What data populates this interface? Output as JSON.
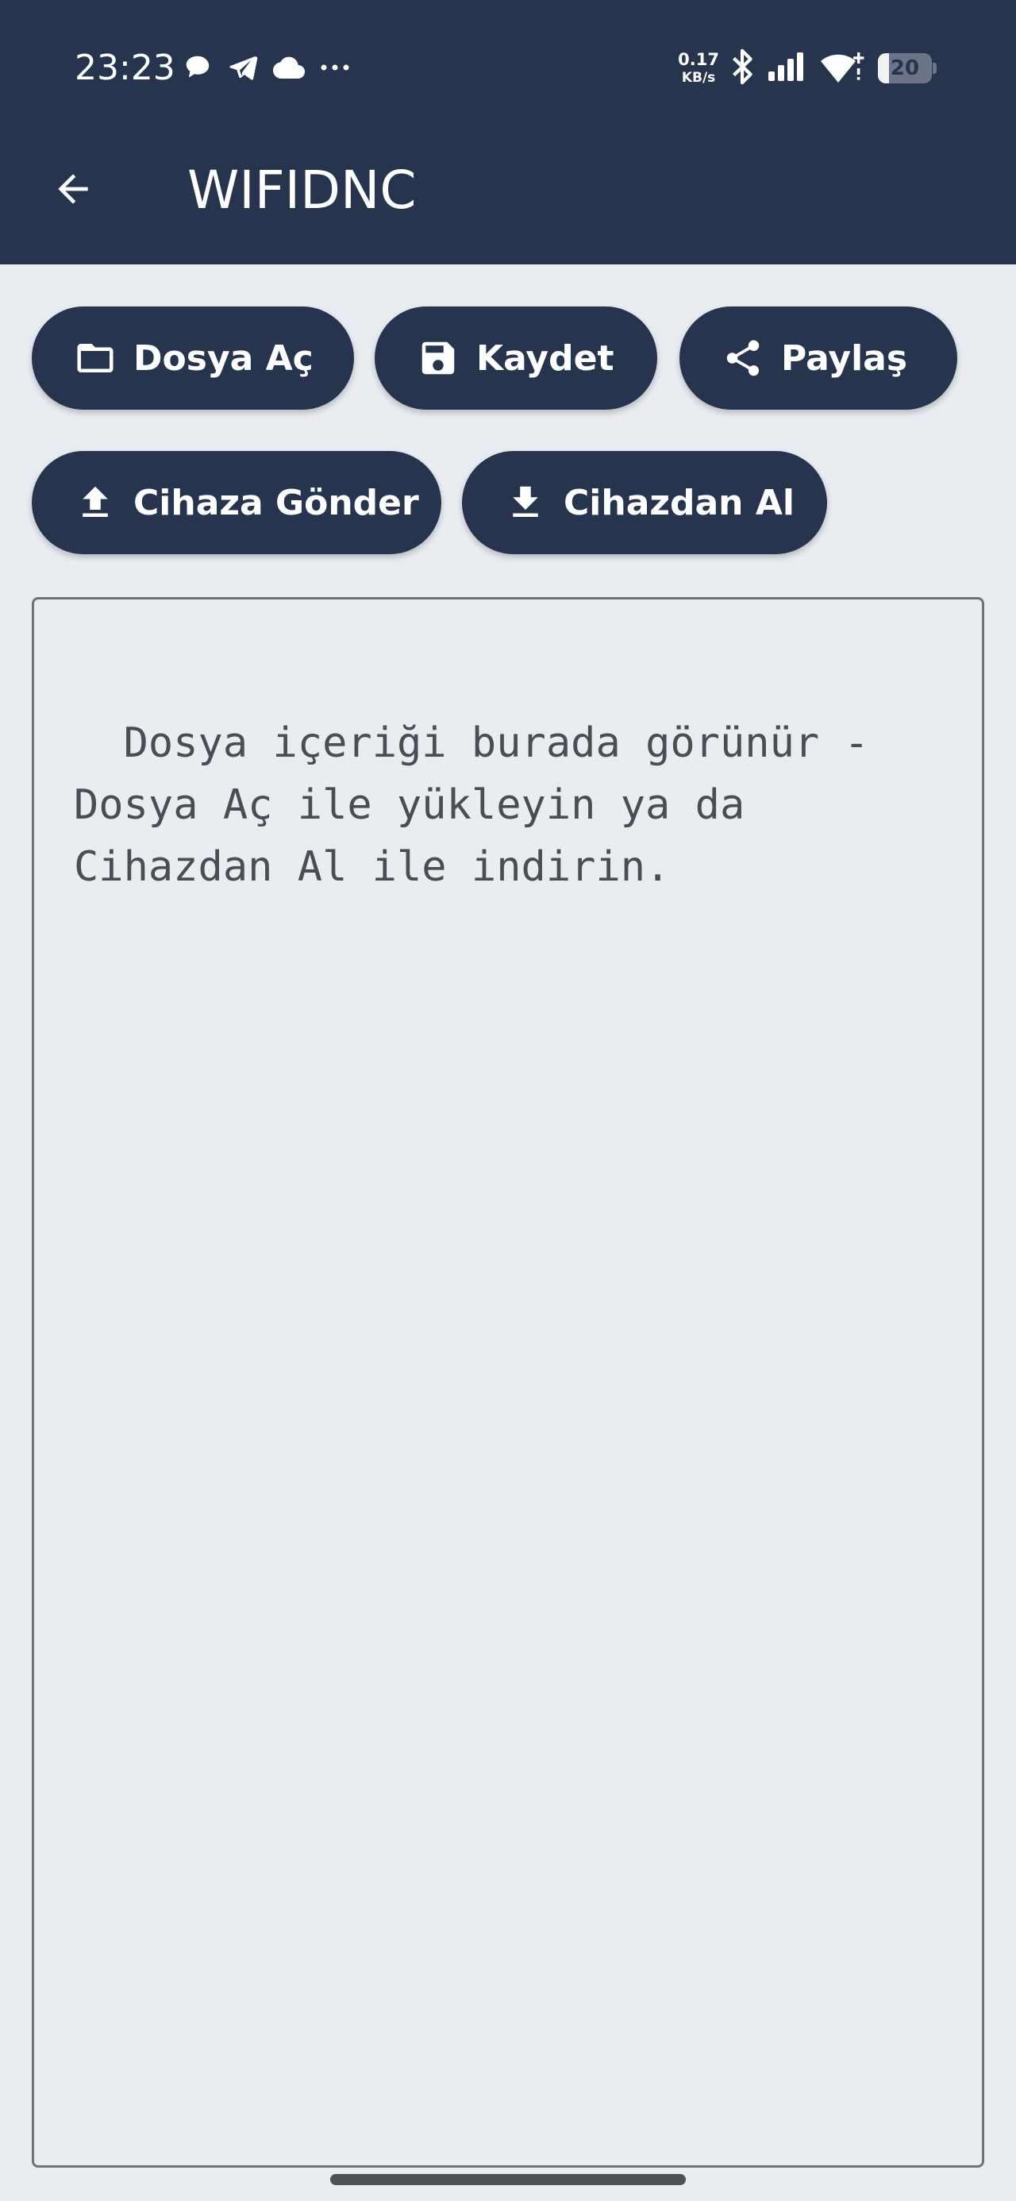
{
  "status_bar": {
    "time": "23:23",
    "net_speed_value": "0.17",
    "net_speed_unit": "KB/s",
    "battery_level": "20",
    "battery_fraction": 0.2
  },
  "app_bar": {
    "title": "WIFIDNC"
  },
  "toolbar": {
    "open_label": "Dosya Aç",
    "save_label": "Kaydet",
    "share_label": "Paylaş",
    "send_label": "Cihaza Gönder",
    "receive_label": "Cihazdan Al"
  },
  "editor": {
    "placeholder": "Dosya içeriği burada görünür -\nDosya Aç ile yükleyin ya da\nCihazdan Al ile indirin."
  },
  "colors": {
    "primary": "#26344E",
    "background": "#E9ECF1"
  }
}
